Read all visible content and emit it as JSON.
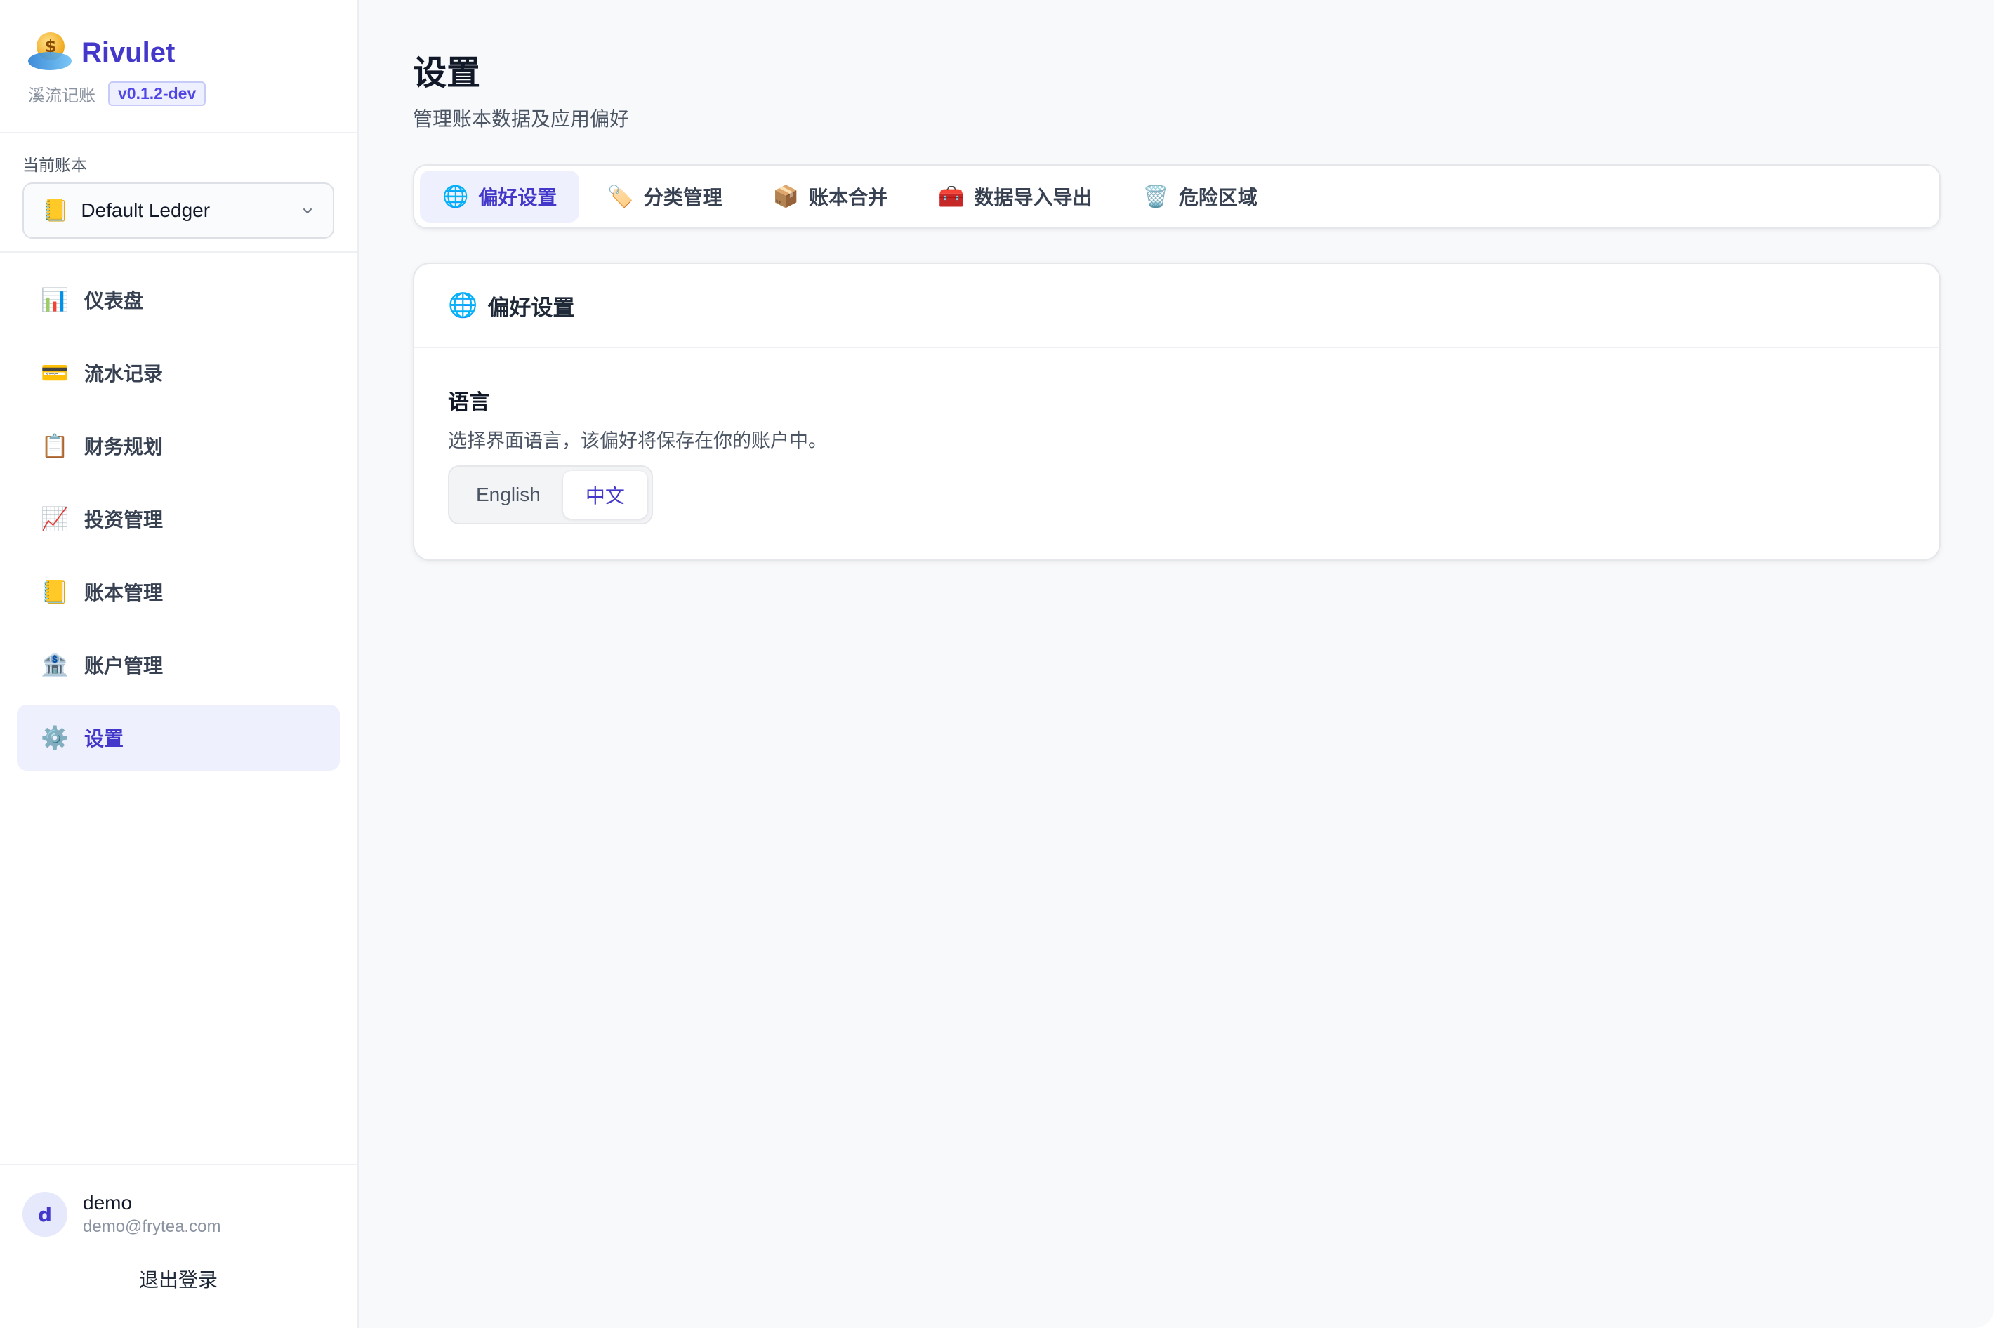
{
  "brand": {
    "name": "Rivulet",
    "subtitle": "溪流记账",
    "version": "v0.1.2-dev"
  },
  "ledger": {
    "label": "当前账本",
    "selected_emoji": "📒",
    "selected": "Default Ledger"
  },
  "nav": {
    "items": [
      {
        "emoji": "📊",
        "label": "仪表盘"
      },
      {
        "emoji": "💳",
        "label": "流水记录"
      },
      {
        "emoji": "📋",
        "label": "财务规划"
      },
      {
        "emoji": "📈",
        "label": "投资管理"
      },
      {
        "emoji": "📒",
        "label": "账本管理"
      },
      {
        "emoji": "🏦",
        "label": "账户管理"
      },
      {
        "emoji": "⚙️",
        "label": "设置"
      }
    ],
    "active_index": 6
  },
  "user": {
    "initial": "d",
    "name": "demo",
    "email": "demo@frytea.com",
    "logout": "退出登录"
  },
  "page": {
    "title": "设置",
    "subtitle": "管理账本数据及应用偏好"
  },
  "tabs": {
    "items": [
      {
        "emoji": "🌐",
        "label": "偏好设置"
      },
      {
        "emoji": "🏷️",
        "label": "分类管理"
      },
      {
        "emoji": "📦",
        "label": "账本合并"
      },
      {
        "emoji": "🧰",
        "label": "数据导入导出"
      },
      {
        "emoji": "🗑️",
        "label": "危险区域"
      }
    ],
    "active_index": 0
  },
  "preferences": {
    "header_emoji": "🌐",
    "header": "偏好设置",
    "language_title": "语言",
    "language_desc": "选择界面语言，该偏好将保存在你的账户中。",
    "options": [
      "English",
      "中文"
    ],
    "selected_index": 1
  },
  "colors": {
    "accent": "#4338ca",
    "active_bg": "#eef0fd"
  }
}
